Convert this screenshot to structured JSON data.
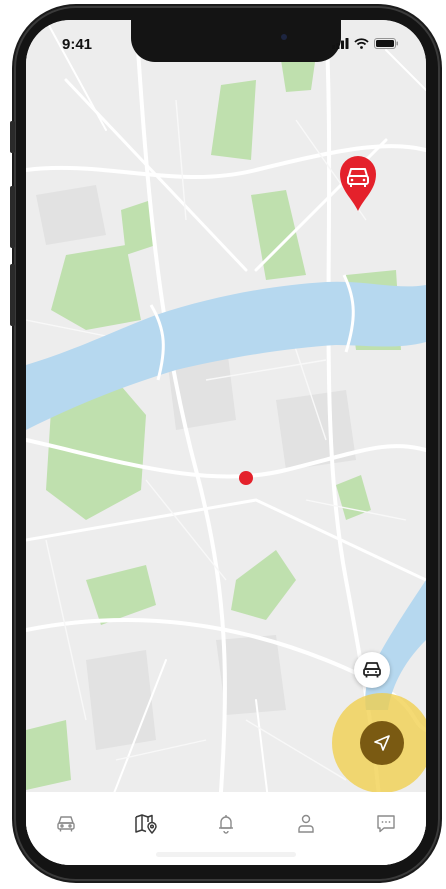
{
  "status_bar": {
    "time": "9:41"
  },
  "colors": {
    "pin": "#e4212b",
    "locate_halo": "#f0ce46",
    "locate_button": "#7a5a12",
    "water": "#b6d8ef",
    "park": "#bfe0ae"
  },
  "map": {
    "destination_pin_icon": "car-icon",
    "current_location_marker": "red-dot"
  },
  "controls": {
    "car_button_icon": "car-icon",
    "locate_button_icon": "navigation-arrow-icon"
  },
  "tab_bar": {
    "items": [
      {
        "icon": "car-icon"
      },
      {
        "icon": "map-pin-icon"
      },
      {
        "icon": "bell-icon"
      },
      {
        "icon": "user-icon"
      },
      {
        "icon": "chat-icon"
      }
    ]
  }
}
